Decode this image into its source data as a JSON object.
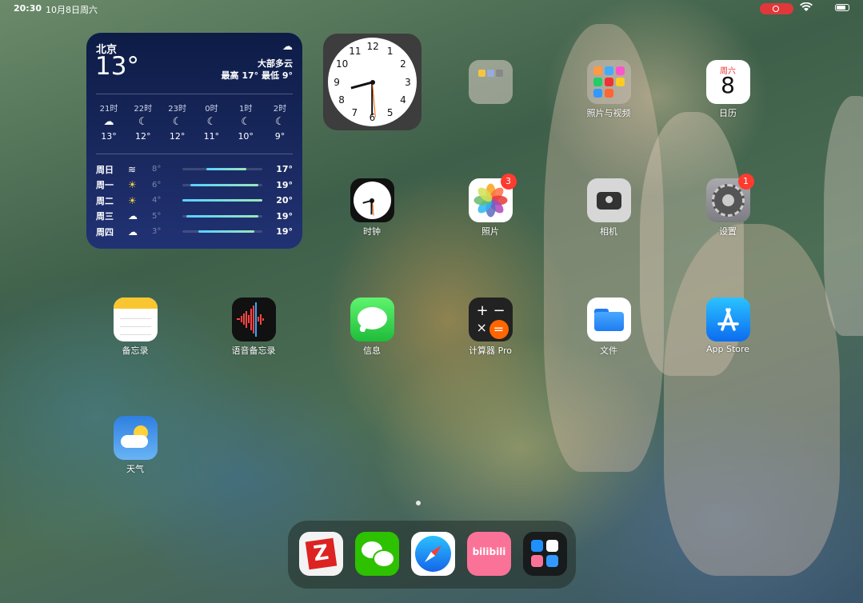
{
  "status_bar": {
    "time": "20:30",
    "date": "10月8日周六",
    "battery_level": 0.75
  },
  "weather_widget": {
    "city": "北京",
    "current_temp": "13°",
    "condition": "大部多云",
    "high_low": "最高 17° 最低 9°",
    "hourly": [
      {
        "time": "21时",
        "icon": "cloud-moon-icon",
        "temp": "13°"
      },
      {
        "time": "22时",
        "icon": "moon-icon",
        "temp": "12°"
      },
      {
        "time": "23时",
        "icon": "moon-icon",
        "temp": "12°"
      },
      {
        "time": "0时",
        "icon": "moon-icon",
        "temp": "11°"
      },
      {
        "time": "1时",
        "icon": "moon-icon",
        "temp": "10°"
      },
      {
        "time": "2时",
        "icon": "moon-icon",
        "temp": "9°"
      }
    ],
    "daily": [
      {
        "day": "周日",
        "icon": "wind-icon",
        "low": "8°",
        "high": "17°",
        "range": [
          0.3,
          0.8
        ]
      },
      {
        "day": "周一",
        "icon": "sun-icon",
        "low": "6°",
        "high": "19°",
        "range": [
          0.1,
          0.95
        ]
      },
      {
        "day": "周二",
        "icon": "sun-icon",
        "low": "4°",
        "high": "20°",
        "range": [
          0.0,
          1.0
        ]
      },
      {
        "day": "周三",
        "icon": "cloud-icon",
        "low": "5°",
        "high": "19°",
        "range": [
          0.05,
          0.95
        ]
      },
      {
        "day": "周四",
        "icon": "cloud-icon",
        "low": "3°",
        "high": "19°",
        "range": [
          0.2,
          0.9
        ]
      }
    ]
  },
  "clock_widget": {
    "hours": 8,
    "minutes": 30
  },
  "apps": [
    {
      "id": "folder",
      "label": "",
      "icon": "folder-icon",
      "badge": ""
    },
    {
      "id": "photos-video",
      "label": "照片与视频",
      "icon": "folder-icon",
      "badge": ""
    },
    {
      "id": "calendar",
      "label": "日历",
      "icon": "calendar-icon",
      "badge": "",
      "weekday": "周六",
      "day": "8"
    },
    {
      "id": "clock",
      "label": "时钟",
      "icon": "clock-icon",
      "badge": ""
    },
    {
      "id": "photos",
      "label": "照片",
      "icon": "photos-icon",
      "badge": "3"
    },
    {
      "id": "camera",
      "label": "相机",
      "icon": "camera-icon",
      "badge": ""
    },
    {
      "id": "settings",
      "label": "设置",
      "icon": "gear-icon",
      "badge": "1"
    },
    {
      "id": "notes",
      "label": "备忘录",
      "icon": "notes-icon",
      "badge": ""
    },
    {
      "id": "voice-memos",
      "label": "语音备忘录",
      "icon": "waveform-icon",
      "badge": ""
    },
    {
      "id": "messages",
      "label": "信息",
      "icon": "message-icon",
      "badge": ""
    },
    {
      "id": "calculator",
      "label": "计算器 Pro",
      "icon": "calculator-icon",
      "badge": ""
    },
    {
      "id": "files",
      "label": "文件",
      "icon": "files-icon",
      "badge": ""
    },
    {
      "id": "app-store",
      "label": "App Store",
      "icon": "app-store-icon",
      "badge": ""
    },
    {
      "id": "weather",
      "label": "天气",
      "icon": "weather-icon",
      "badge": ""
    }
  ],
  "dock": [
    {
      "id": "zotero",
      "icon": "zotero-icon",
      "glyph": "Z"
    },
    {
      "id": "wechat",
      "icon": "wechat-icon",
      "glyph": ""
    },
    {
      "id": "safari",
      "icon": "compass-icon",
      "glyph": ""
    },
    {
      "id": "bilibili",
      "icon": "bilibili-icon",
      "glyph": "bilibili"
    },
    {
      "id": "app-library",
      "icon": "app-library-icon",
      "glyph": ""
    }
  ]
}
